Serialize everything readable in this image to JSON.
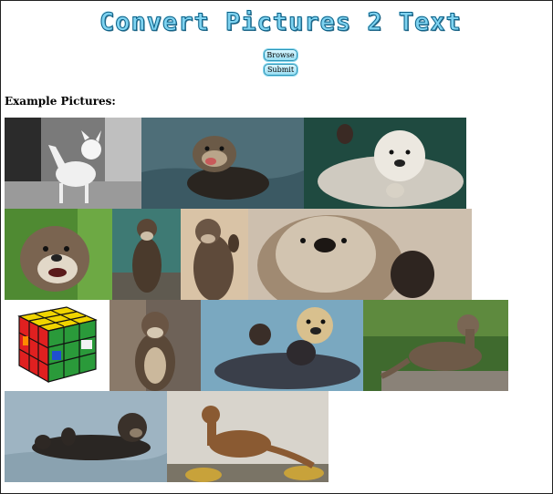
{
  "header": {
    "logo_text": "Convert Pictures 2 Text"
  },
  "form": {
    "browse_label": "Browse",
    "submit_label": "Submit"
  },
  "examples": {
    "heading": "Example Pictures:"
  },
  "colors": {
    "logo_fill": "#7fd3f0",
    "logo_outline": "#0b5f86",
    "button_fill": "#a6e3f5"
  }
}
